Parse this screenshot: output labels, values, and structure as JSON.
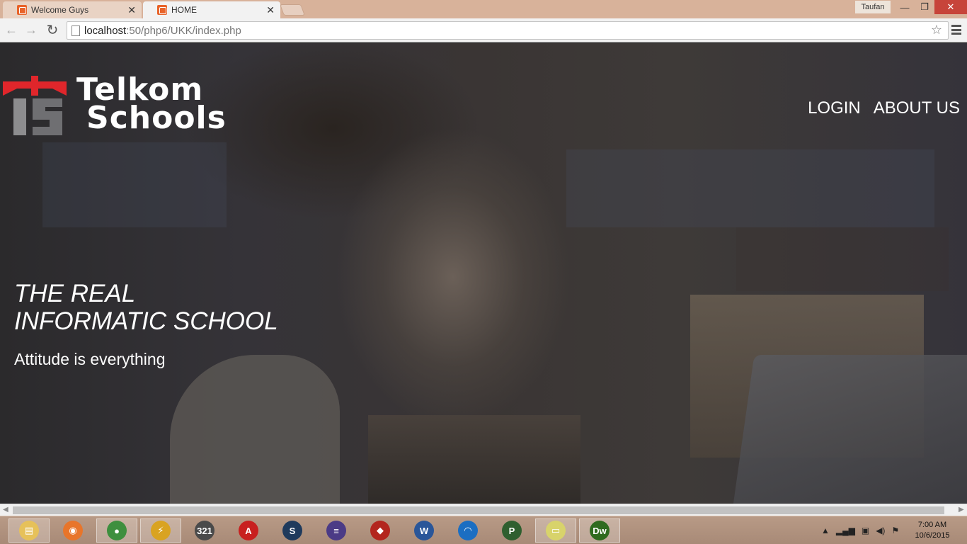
{
  "browser": {
    "tabs": [
      {
        "title": "Welcome Guys",
        "active": false
      },
      {
        "title": "HOME",
        "active": true
      }
    ],
    "user": "Taufan",
    "url_host": "localhost",
    "url_path": ":50/php6/UKK/index.php"
  },
  "page": {
    "logo": {
      "line1": "Telkom",
      "line2": "Schools"
    },
    "nav": {
      "login": "LOGIN",
      "about": "ABOUT US"
    },
    "hero": {
      "title_line1": "THE REAL",
      "title_line2": "INFORMATIC SCHOOL",
      "subtitle": "Attitude is everything"
    }
  },
  "taskbar": {
    "apps": [
      {
        "name": "file-explorer-icon",
        "color": "#e6c15a",
        "glyph": "▤",
        "active": true
      },
      {
        "name": "firefox-icon",
        "color": "#e8752a",
        "glyph": "◉",
        "active": false
      },
      {
        "name": "chrome-icon",
        "color": "#3e8f3e",
        "glyph": "●",
        "active": true
      },
      {
        "name": "winamp-icon",
        "color": "#d9a321",
        "glyph": "⚡",
        "active": true
      },
      {
        "name": "media-player-classic-icon",
        "color": "#4a4a4a",
        "glyph": "321",
        "active": false
      },
      {
        "name": "acrobat-icon",
        "color": "#c8201f",
        "glyph": "A",
        "active": false
      },
      {
        "name": "steam-icon",
        "color": "#1f3a5c",
        "glyph": "S",
        "active": false
      },
      {
        "name": "eclipse-icon",
        "color": "#4b3b86",
        "glyph": "≡",
        "active": false
      },
      {
        "name": "cubase-icon",
        "color": "#b3261e",
        "glyph": "◆",
        "active": false
      },
      {
        "name": "word-icon",
        "color": "#2a5699",
        "glyph": "W",
        "active": false
      },
      {
        "name": "network-icon",
        "color": "#1b6ec2",
        "glyph": "◠",
        "active": false
      },
      {
        "name": "app-x-icon",
        "color": "#2f5f2f",
        "glyph": "P",
        "active": false
      },
      {
        "name": "sticky-notes-icon",
        "color": "#d8d36b",
        "glyph": "▭",
        "active": true
      },
      {
        "name": "dreamweaver-icon",
        "color": "#2f6b1f",
        "glyph": "Dw",
        "active": true
      }
    ],
    "time": "7:00 AM",
    "date": "10/6/2015"
  }
}
